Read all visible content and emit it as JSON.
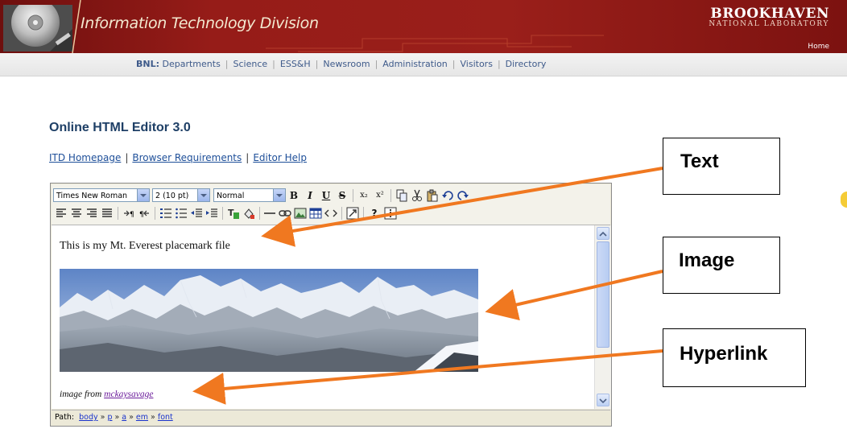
{
  "header": {
    "division_title": "Information Technology Division",
    "logo_main": "BROOKHAVEN",
    "logo_sub": "NATIONAL LABORATORY",
    "home_link": "Home",
    "colors": {
      "banner": "#8b1614",
      "title": "#f3e9d0"
    }
  },
  "nav": {
    "prefix": "BNL:",
    "items": [
      "Departments",
      "Science",
      "ESS&H",
      "Newsroom",
      "Administration",
      "Visitors",
      "Directory"
    ]
  },
  "page": {
    "title": "Online HTML Editor 3.0",
    "links": [
      "ITD Homepage",
      "Browser Requirements",
      "Editor Help"
    ]
  },
  "editor": {
    "font_family_value": "Times New Roman",
    "font_size_value": "2 (10 pt)",
    "format_value": "Normal",
    "toolbar_row1": [
      "B",
      "I",
      "U",
      "S",
      "x₂",
      "x²"
    ],
    "toolbar_row2_help": "?",
    "content_text": "This is my Mt. Everest placemark file",
    "image_icon": "mountain-panorama",
    "caption_prefix": "image from",
    "caption_link": "mckaysavage",
    "path_label": "Path:",
    "path_items": [
      "body",
      "p",
      "a",
      "em",
      "font"
    ],
    "path_separator": "»"
  },
  "callouts": {
    "text": "Text",
    "image": "Image",
    "hyperlink": "Hyperlink",
    "arrow_color": "#f07820"
  }
}
